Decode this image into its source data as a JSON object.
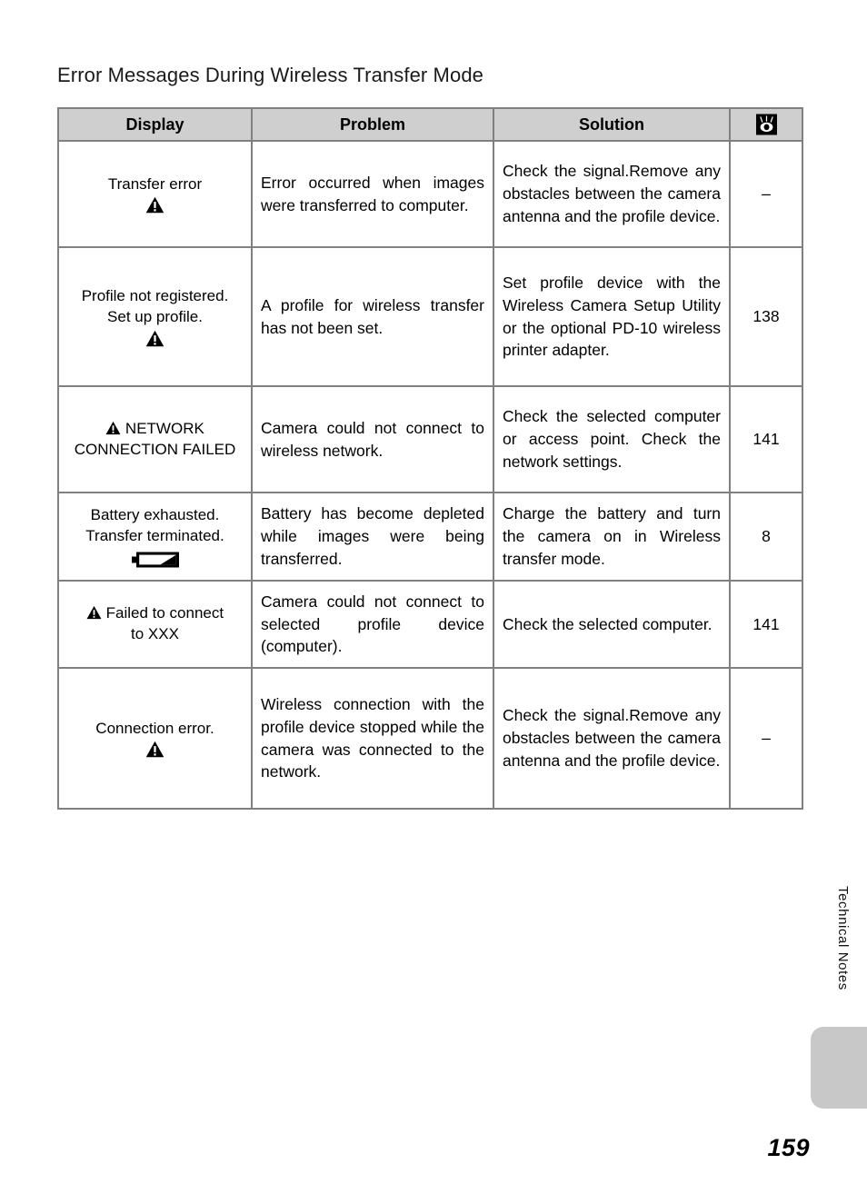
{
  "page": {
    "title": "Error Messages During Wireless Transfer Mode",
    "number": "159",
    "side_tab_label": "Technical Notes"
  },
  "table": {
    "headers": {
      "display": "Display",
      "problem": "Problem",
      "solution": "Solution",
      "reference": "eye-reference-icon"
    },
    "rows": [
      {
        "display_lines": [
          "Transfer error"
        ],
        "display_icon": "warning-triangle-icon",
        "icon_position": "below",
        "problem": "Error occurred when images were transferred to computer.",
        "solution": "Check the signal.Remove any obstacles between the camera antenna and the profile device.",
        "reference": "–"
      },
      {
        "display_lines": [
          "Profile not registered.",
          "Set up profile."
        ],
        "display_icon": "warning-triangle-icon",
        "icon_position": "below",
        "problem": "A profile for wireless transfer has not been set.",
        "solution": "Set profile device with the Wireless Camera Setup Utility or the optional PD-10 wireless printer adapter.",
        "reference": "138"
      },
      {
        "display_lines": [
          "NETWORK",
          "CONNECTION FAILED"
        ],
        "display_icon": "warning-triangle-icon",
        "icon_position": "inline-first-line",
        "problem": "Camera could not connect to wireless network.",
        "solution": "Check the selected computer or access point. Check the network settings.",
        "reference": "141"
      },
      {
        "display_lines": [
          "Battery exhausted.",
          "Transfer terminated."
        ],
        "display_icon": "battery-empty-icon",
        "icon_position": "below",
        "problem": "Battery has become depleted while images were being transferred.",
        "solution": "Charge the battery and turn the camera on in Wireless transfer mode.",
        "reference": "8"
      },
      {
        "display_lines": [
          "Failed to connect",
          "to XXX"
        ],
        "display_icon": "warning-triangle-icon",
        "icon_position": "inline-first-line",
        "problem": "Camera could not connect to selected profile device (computer).",
        "solution": "Check the selected computer.",
        "reference": "141"
      },
      {
        "display_lines": [
          "Connection error."
        ],
        "display_icon": "warning-triangle-icon",
        "icon_position": "below",
        "problem": "Wireless connection with the profile device stopped while the camera was connected to the network.",
        "solution": "Check the signal.Remove any obstacles between the camera antenna and the profile device.",
        "reference": "–"
      }
    ]
  },
  "colors": {
    "header_fill": "#cfcfcf",
    "border": "#808080",
    "side_tab": "#c8c8c8",
    "text": "#000000"
  }
}
